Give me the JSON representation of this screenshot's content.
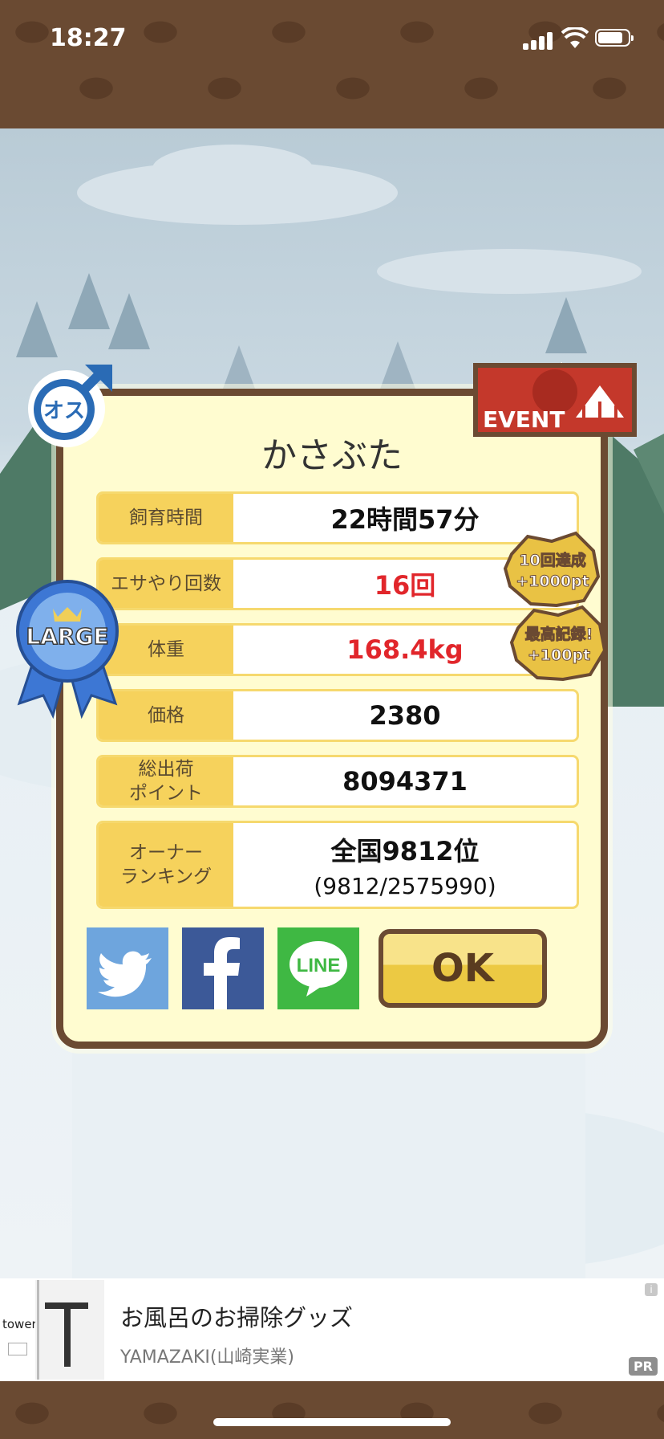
{
  "status_bar": {
    "time": "18:27"
  },
  "card": {
    "title": "かさぶた",
    "rows": [
      {
        "label": "飼育時間",
        "value": "22時間57分"
      },
      {
        "label": "エサやり回数",
        "value": "16回"
      },
      {
        "label": "体重",
        "value": "168.4kg"
      },
      {
        "label": "価格",
        "value": "2380"
      },
      {
        "label": "総出荷\nポイント",
        "value": "8094371"
      },
      {
        "label": "オーナー\nランキング",
        "value": "全国9812位",
        "sub": "(9812/2575990)"
      }
    ],
    "ok_label": "OK",
    "share": {
      "line_label": "LINE"
    }
  },
  "badges": {
    "gender": "オス",
    "size": "LARGE",
    "event": "EVENT",
    "bonus1_line1": "10回達成",
    "bonus1_line2": "+1000pt",
    "bonus2_line1": "最高記録!",
    "bonus2_line2": "+100pt"
  },
  "ad": {
    "title": "お風呂のお掃除グッズ",
    "subtitle": "YAMAZAKI(山崎実業)",
    "brand": "tower",
    "pr_label": "PR",
    "info_label": "i"
  },
  "colors": {
    "card_bg": "#fffcd0",
    "label_bg": "#f6d25c",
    "highlight_red": "#e1262b"
  }
}
